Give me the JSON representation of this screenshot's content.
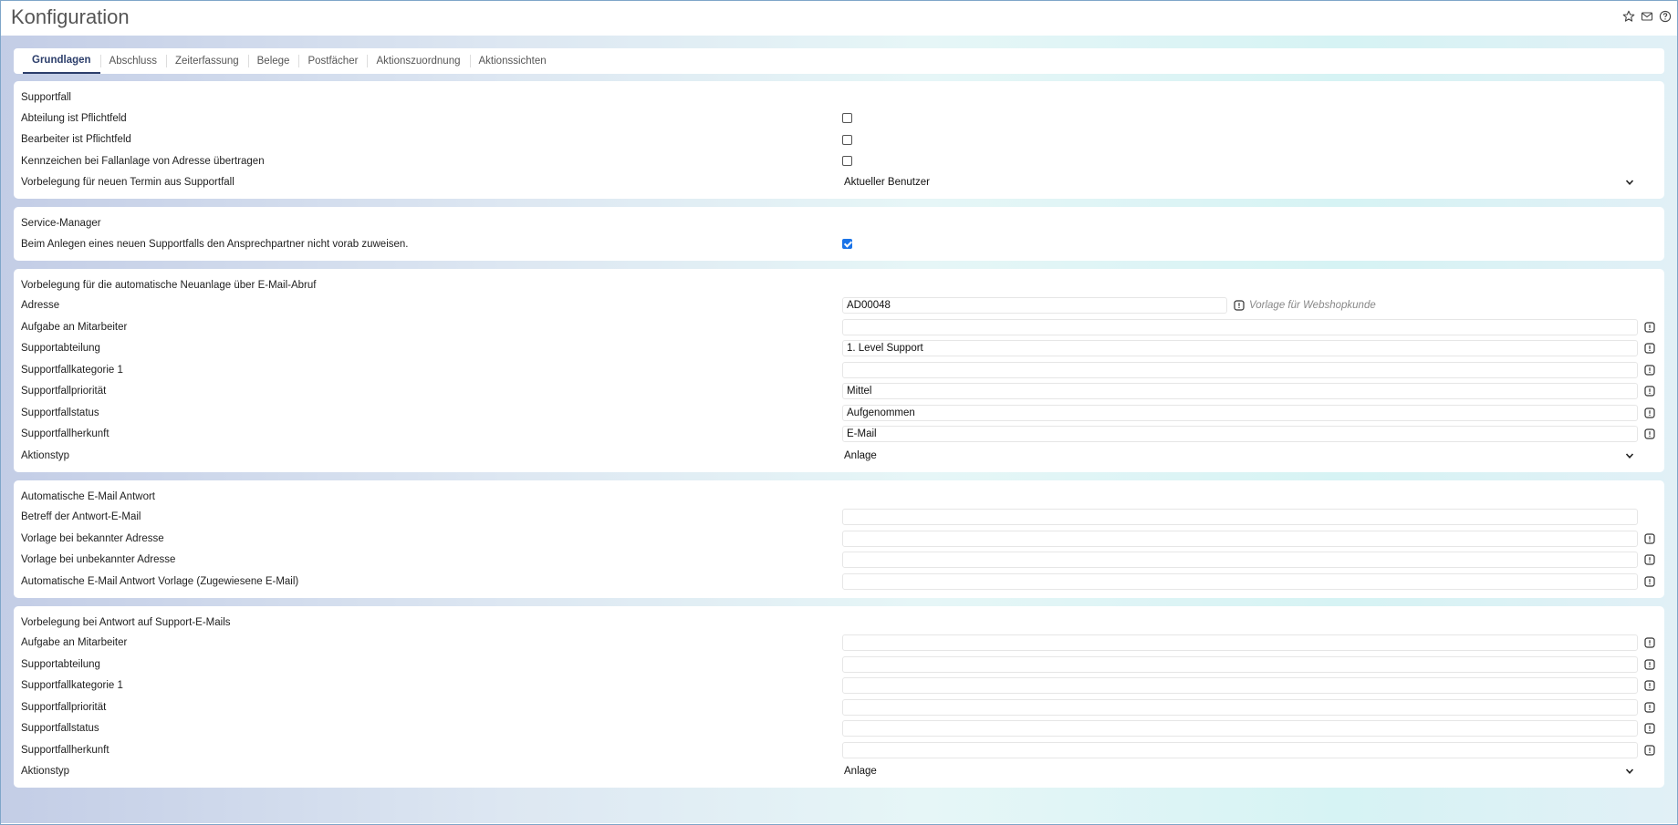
{
  "header": {
    "title": "Konfiguration"
  },
  "tabs": [
    {
      "label": "Grundlagen"
    },
    {
      "label": "Abschluss"
    },
    {
      "label": "Zeiterfassung"
    },
    {
      "label": "Belege"
    },
    {
      "label": "Postfächer"
    },
    {
      "label": "Aktionszuordnung"
    },
    {
      "label": "Aktionssichten"
    }
  ],
  "supportfall": {
    "title": "Supportfall",
    "abteilung_label": "Abteilung ist Pflichtfeld",
    "bearbeiter_label": "Bearbeiter ist Pflichtfeld",
    "kennzeichen_label": "Kennzeichen bei Fallanlage von Adresse übertragen",
    "vorbelegung_label": "Vorbelegung für neuen Termin aus Supportfall",
    "vorbelegung_value": "Aktueller Benutzer"
  },
  "service_manager": {
    "title": "Service-Manager",
    "zuweisen_label": "Beim Anlegen eines neuen Supportfalls den Ansprechpartner nicht vorab zuweisen."
  },
  "email_abruf": {
    "title": "Vorbelegung für die automatische Neuanlage über E-Mail-Abruf",
    "adresse_label": "Adresse",
    "adresse_value": "AD00048",
    "adresse_hint": "Vorlage für Webshopkunde",
    "aufgabe_label": "Aufgabe an Mitarbeiter",
    "aufgabe_value": "",
    "abteilung_label": "Supportabteilung",
    "abteilung_value": "1. Level Support",
    "kategorie_label": "Supportfallkategorie 1",
    "kategorie_value": "",
    "prioritaet_label": "Supportfallpriorität",
    "prioritaet_value": "Mittel",
    "status_label": "Supportfallstatus",
    "status_value": "Aufgenommen",
    "herkunft_label": "Supportfallherkunft",
    "herkunft_value": "E-Mail",
    "aktionstyp_label": "Aktionstyp",
    "aktionstyp_value": "Anlage"
  },
  "auto_antwort": {
    "title": "Automatische E-Mail Antwort",
    "betreff_label": "Betreff der Antwort-E-Mail",
    "betreff_value": "",
    "bekannt_label": "Vorlage bei bekannter Adresse",
    "bekannt_value": "",
    "unbekannt_label": "Vorlage bei unbekannter Adresse",
    "unbekannt_value": "",
    "zugewiesen_label": "Automatische E-Mail Antwort Vorlage (Zugewiesene E-Mail)",
    "zugewiesen_value": ""
  },
  "antwort_support": {
    "title": "Vorbelegung bei Antwort auf Support-E-Mails",
    "aufgabe_label": "Aufgabe an Mitarbeiter",
    "aufgabe_value": "",
    "abteilung_label": "Supportabteilung",
    "abteilung_value": "",
    "kategorie_label": "Supportfallkategorie 1",
    "kategorie_value": "",
    "prioritaet_label": "Supportfallpriorität",
    "prioritaet_value": "",
    "status_label": "Supportfallstatus",
    "status_value": "",
    "herkunft_label": "Supportfallherkunft",
    "herkunft_value": "",
    "aktionstyp_label": "Aktionstyp",
    "aktionstyp_value": "Anlage"
  },
  "icons": {
    "favorite": "star-icon",
    "mail": "mail-icon",
    "help": "help-icon",
    "lookup": "lookup-icon",
    "dropdown": "chevron-down-icon"
  }
}
